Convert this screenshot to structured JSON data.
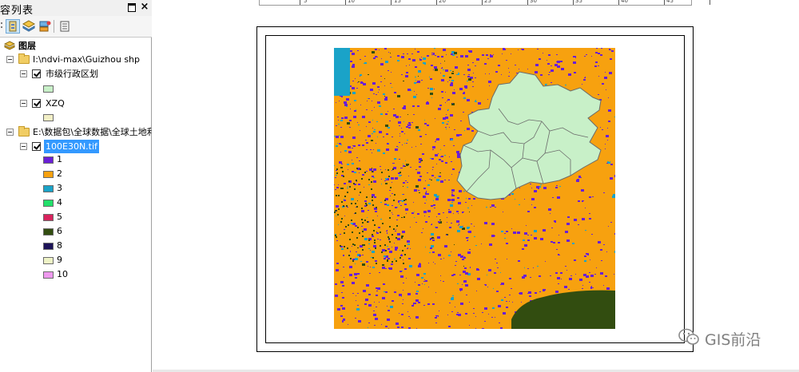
{
  "toc": {
    "title": "容列表",
    "pin_icon": "pin-icon",
    "close_label": "×",
    "toolbar": [
      "list-by-drawing-order-icon",
      "list-by-source-icon",
      "list-by-visibility-icon",
      "options-icon"
    ],
    "layers_root": "图层",
    "groups": [
      {
        "path": "I:\\ndvi-max\\Guizhou shp",
        "layers": [
          {
            "name": "市级行政区划",
            "symbol_color": "#c8f0c8"
          },
          {
            "name": "XZQ",
            "symbol_color": "#f2efc6"
          }
        ]
      },
      {
        "path": "E:\\数据包\\全球数据\\全球土地利",
        "layers": [
          {
            "name": "100E30N.tif"
          }
        ]
      }
    ],
    "legend": [
      {
        "value": "1",
        "color": "#6a1fd6"
      },
      {
        "value": "2",
        "color": "#f7a10f"
      },
      {
        "value": "3",
        "color": "#1aa3c8"
      },
      {
        "value": "4",
        "color": "#22e06a"
      },
      {
        "value": "5",
        "color": "#d8245e"
      },
      {
        "value": "6",
        "color": "#324d10"
      },
      {
        "value": "8",
        "color": "#1c1358"
      },
      {
        "value": "9",
        "color": "#eef3c6"
      },
      {
        "value": "10",
        "color": "#ee99ee"
      }
    ]
  },
  "ruler_numbers": [
    "5",
    "10",
    "15",
    "20",
    "25",
    "30",
    "35",
    "40",
    "45"
  ],
  "map_colors": {
    "orange": "#f7a10f",
    "purple": "#6a1fd6",
    "cyan": "#1aa3c8",
    "dark_green": "#324d10",
    "guizhou_fill": "#c8f0c8",
    "boundary": "#6b6b6b"
  },
  "watermark": {
    "text": "GIS前沿",
    "icon": "wechat-icon"
  }
}
